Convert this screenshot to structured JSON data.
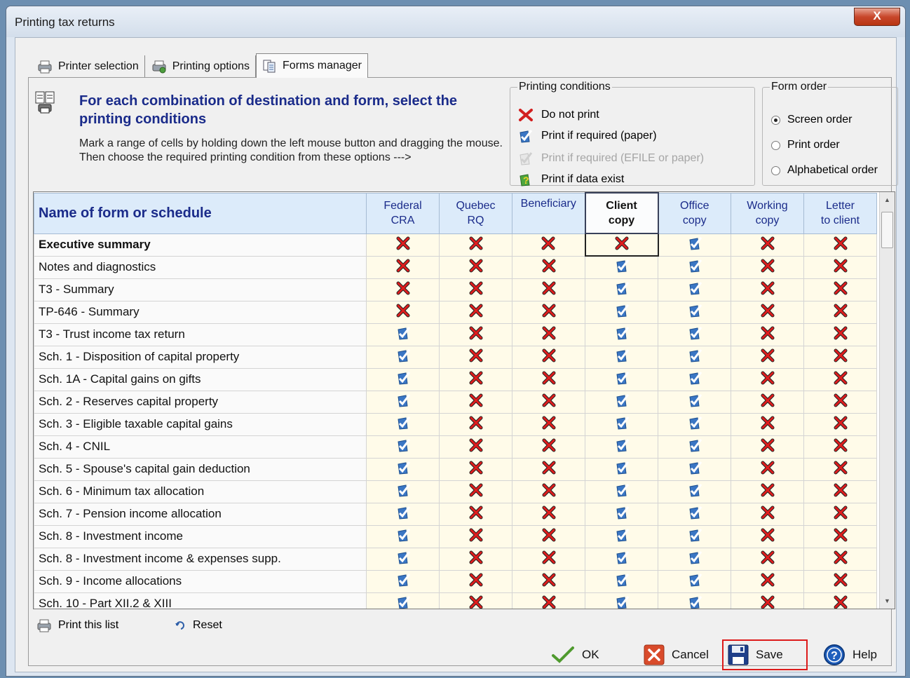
{
  "window": {
    "title": "Printing tax returns",
    "close_glyph": "X"
  },
  "tabs": [
    {
      "label": "Printer selection",
      "icon": "printer-icon"
    },
    {
      "label": "Printing options",
      "icon": "printer-options-icon"
    },
    {
      "label": "Forms manager",
      "icon": "forms-icon",
      "active": true
    }
  ],
  "header": {
    "title": "For each combination of destination and form, select the printing conditions",
    "description": "Mark a range of cells by holding down the left mouse button and dragging the mouse. Then choose the required printing condition from these options --->"
  },
  "printing_conditions": {
    "legend": "Printing conditions",
    "options": [
      {
        "label": "Do not print",
        "icon": "red-x-icon"
      },
      {
        "label": "Print if required (paper)",
        "icon": "blue-check-icon"
      },
      {
        "label": "Print if required (EFILE or paper)",
        "icon": "efile-icon",
        "disabled": true
      },
      {
        "label": "Print if data exist",
        "icon": "question-icon"
      }
    ]
  },
  "form_order": {
    "legend": "Form order",
    "options": [
      {
        "label": "Screen order",
        "checked": true
      },
      {
        "label": "Print order",
        "checked": false
      },
      {
        "label": "Alphabetical order",
        "checked": false
      }
    ]
  },
  "grid": {
    "name_header": "Name of form or schedule",
    "columns": [
      {
        "line1": "Federal",
        "line2": "CRA"
      },
      {
        "line1": "Quebec",
        "line2": "RQ"
      },
      {
        "line1": "Beneficiary",
        "line2": ""
      },
      {
        "line1": "Client",
        "line2": "copy",
        "active": true
      },
      {
        "line1": "Office",
        "line2": "copy"
      },
      {
        "line1": "Working",
        "line2": "copy"
      },
      {
        "line1": "Letter",
        "line2": "to client"
      }
    ],
    "rows": [
      {
        "name": "Executive summary",
        "bold": true,
        "cells": [
          "x",
          "x",
          "x",
          "x",
          "c",
          "x",
          "x"
        ]
      },
      {
        "name": "Notes and diagnostics",
        "cells": [
          "x",
          "x",
          "x",
          "c",
          "c",
          "x",
          "x"
        ]
      },
      {
        "name": "T3 - Summary",
        "cells": [
          "x",
          "x",
          "x",
          "c",
          "c",
          "x",
          "x"
        ]
      },
      {
        "name": "TP-646 - Summary",
        "cells": [
          "x",
          "x",
          "x",
          "c",
          "c",
          "x",
          "x"
        ]
      },
      {
        "name": "T3 - Trust income tax return",
        "cells": [
          "c",
          "x",
          "x",
          "c",
          "c",
          "x",
          "x"
        ]
      },
      {
        "name": "Sch. 1 - Disposition of capital property",
        "cells": [
          "c",
          "x",
          "x",
          "c",
          "c",
          "x",
          "x"
        ]
      },
      {
        "name": "Sch. 1A - Capital gains on gifts",
        "cells": [
          "c",
          "x",
          "x",
          "c",
          "c",
          "x",
          "x"
        ]
      },
      {
        "name": "Sch. 2 - Reserves capital property",
        "cells": [
          "c",
          "x",
          "x",
          "c",
          "c",
          "x",
          "x"
        ]
      },
      {
        "name": "Sch. 3 - Eligible taxable capital gains",
        "cells": [
          "c",
          "x",
          "x",
          "c",
          "c",
          "x",
          "x"
        ]
      },
      {
        "name": "Sch. 4 - CNIL",
        "cells": [
          "c",
          "x",
          "x",
          "c",
          "c",
          "x",
          "x"
        ]
      },
      {
        "name": "Sch. 5 - Spouse's capital gain deduction",
        "cells": [
          "c",
          "x",
          "x",
          "c",
          "c",
          "x",
          "x"
        ]
      },
      {
        "name": "Sch. 6 - Minimum tax allocation",
        "cells": [
          "c",
          "x",
          "x",
          "c",
          "c",
          "x",
          "x"
        ]
      },
      {
        "name": "Sch. 7 - Pension income allocation",
        "cells": [
          "c",
          "x",
          "x",
          "c",
          "c",
          "x",
          "x"
        ]
      },
      {
        "name": "Sch. 8 - Investment income",
        "cells": [
          "c",
          "x",
          "x",
          "c",
          "c",
          "x",
          "x"
        ]
      },
      {
        "name": "Sch. 8 - Investment income & expenses supp.",
        "cells": [
          "c",
          "x",
          "x",
          "c",
          "c",
          "x",
          "x"
        ]
      },
      {
        "name": "Sch. 9 - Income allocations",
        "cells": [
          "c",
          "x",
          "x",
          "c",
          "c",
          "x",
          "x"
        ]
      },
      {
        "name": "Sch. 10 - Part XII.2 & XIII",
        "cells": [
          "c",
          "x",
          "x",
          "c",
          "c",
          "x",
          "x"
        ]
      }
    ]
  },
  "footer_links": {
    "print_list": "Print this list",
    "reset": "Reset"
  },
  "buttons": {
    "ok": "OK",
    "cancel": "Cancel",
    "save": "Save",
    "help": "Help"
  },
  "colors": {
    "title_blue": "#1a2b8a",
    "highlight_red": "#dd1b1b",
    "cell_bg": "#fffbe9"
  }
}
